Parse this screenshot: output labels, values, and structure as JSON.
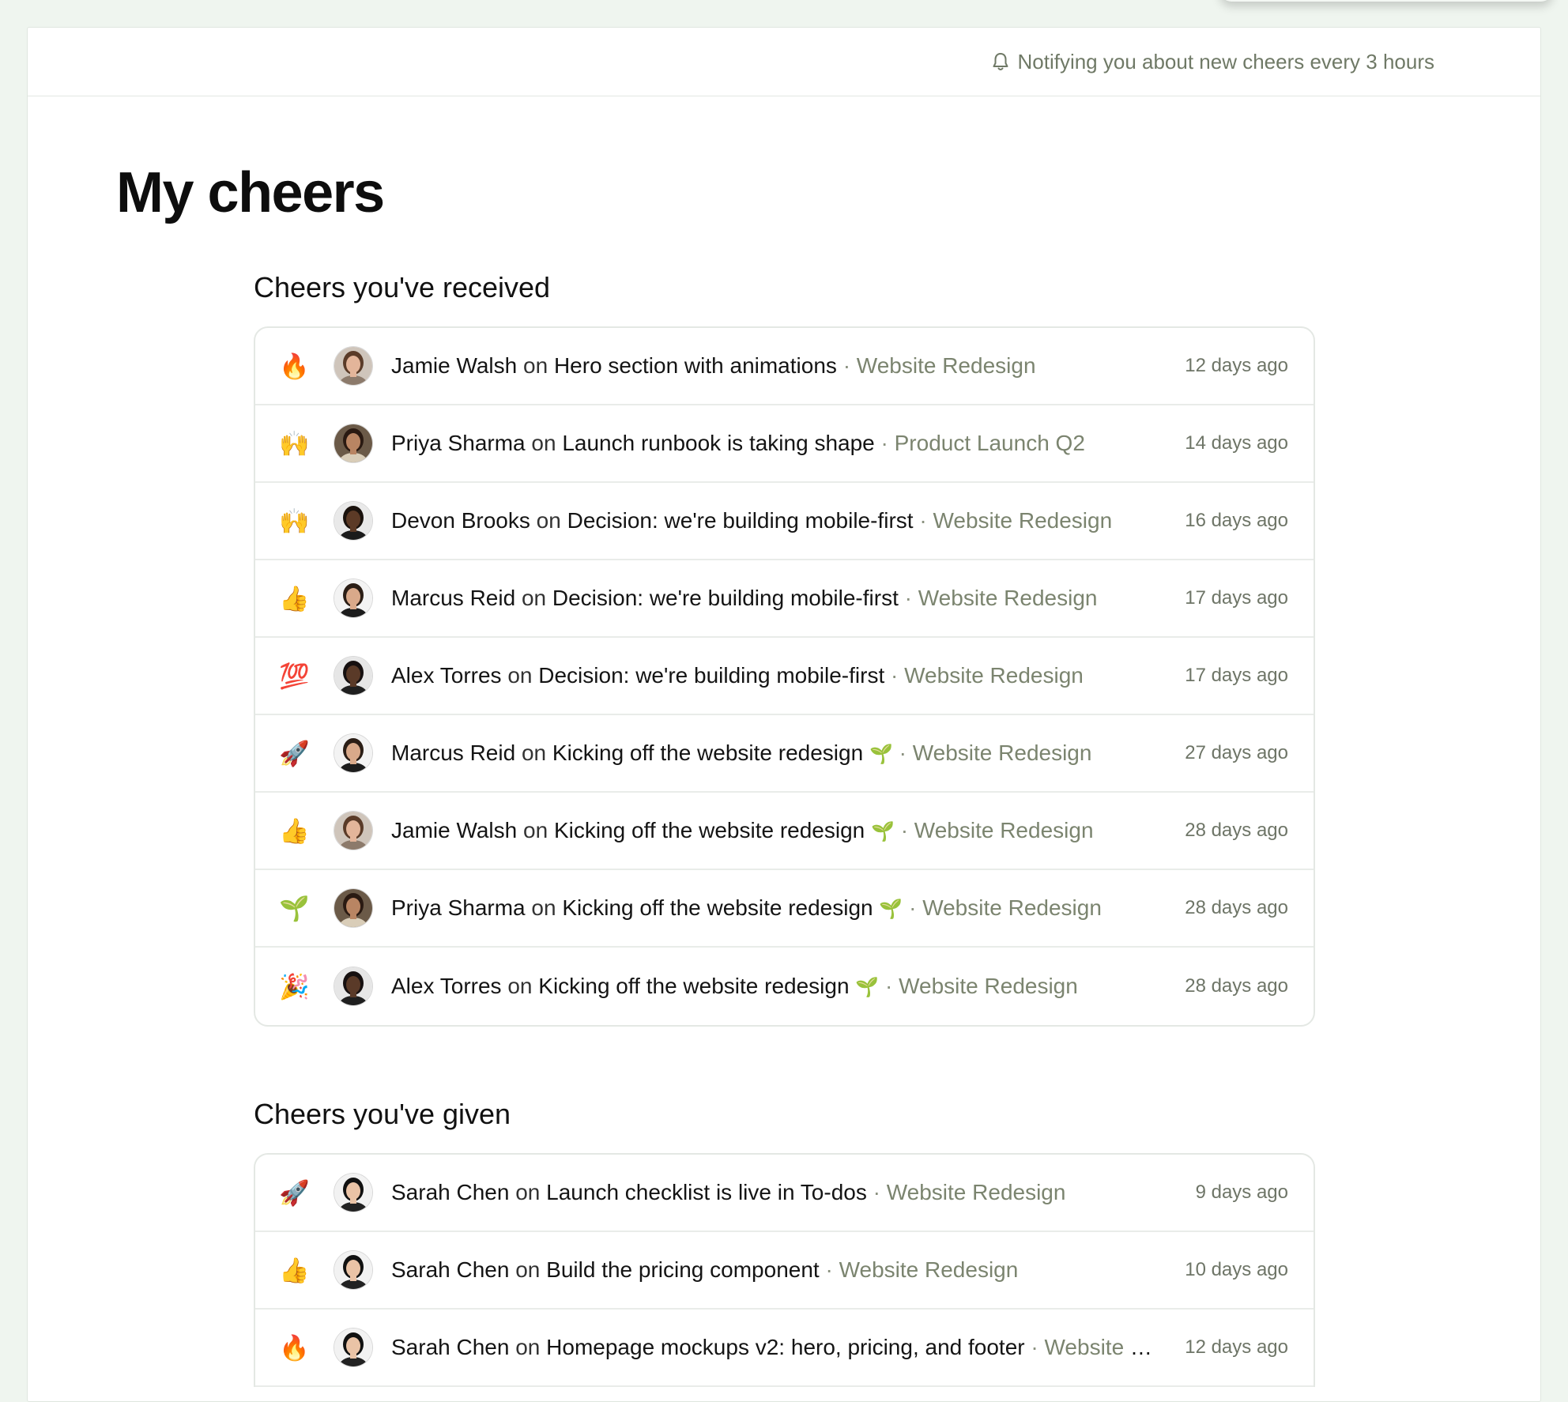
{
  "header": {
    "notify_icon": "bell-icon",
    "notify_text": "Notifying you about new cheers every 3 hours"
  },
  "page_title": "My cheers",
  "received": {
    "title": "Cheers you've received",
    "items": [
      {
        "emoji": "🔥",
        "person": "Jamie Walsh",
        "on": "on",
        "post": "Hero section with animations",
        "post_emoji": "",
        "project": "Website Redesign",
        "time": "12 days ago",
        "avatar": "jamie"
      },
      {
        "emoji": "🙌",
        "person": "Priya Sharma",
        "on": "on",
        "post": "Launch runbook is taking shape",
        "post_emoji": "",
        "project": "Product Launch Q2",
        "time": "14 days ago",
        "avatar": "priya"
      },
      {
        "emoji": "🙌",
        "person": "Devon Brooks",
        "on": "on",
        "post": "Decision: we're building mobile-first",
        "post_emoji": "",
        "project": "Website Redesign",
        "time": "16 days ago",
        "avatar": "devon"
      },
      {
        "emoji": "👍",
        "person": "Marcus Reid",
        "on": "on",
        "post": "Decision: we're building mobile-first",
        "post_emoji": "",
        "project": "Website Redesign",
        "time": "17 days ago",
        "avatar": "marcus"
      },
      {
        "emoji": "💯",
        "person": "Alex Torres",
        "on": "on",
        "post": "Decision: we're building mobile-first",
        "post_emoji": "",
        "project": "Website Redesign",
        "time": "17 days ago",
        "avatar": "alex"
      },
      {
        "emoji": "🚀",
        "person": "Marcus Reid",
        "on": "on",
        "post": "Kicking off the website redesign",
        "post_emoji": "🌱",
        "project": "Website Redesign",
        "time": "27 days ago",
        "avatar": "marcus"
      },
      {
        "emoji": "👍",
        "person": "Jamie Walsh",
        "on": "on",
        "post": "Kicking off the website redesign",
        "post_emoji": "🌱",
        "project": "Website Redesign",
        "time": "28 days ago",
        "avatar": "jamie"
      },
      {
        "emoji": "🌱",
        "person": "Priya Sharma",
        "on": "on",
        "post": "Kicking off the website redesign",
        "post_emoji": "🌱",
        "project": "Website Redesign",
        "time": "28 days ago",
        "avatar": "priya"
      },
      {
        "emoji": "🎉",
        "person": "Alex Torres",
        "on": "on",
        "post": "Kicking off the website redesign",
        "post_emoji": "🌱",
        "project": "Website Redesign",
        "time": "28 days ago",
        "avatar": "alex"
      }
    ]
  },
  "given": {
    "title": "Cheers you've given",
    "items": [
      {
        "emoji": "🚀",
        "person": "Sarah Chen",
        "on": "on",
        "post": "Launch checklist is live in To-dos",
        "post_emoji": "",
        "project": "Website Redesign",
        "time": "9 days ago",
        "avatar": "sarah"
      },
      {
        "emoji": "👍",
        "person": "Sarah Chen",
        "on": "on",
        "post": "Build the pricing component",
        "post_emoji": "",
        "project": "Website Redesign",
        "time": "10 days ago",
        "avatar": "sarah"
      },
      {
        "emoji": "🔥",
        "person": "Sarah Chen",
        "on": "on",
        "post": "Homepage mockups v2: hero, pricing, and footer",
        "post_emoji": "",
        "project": "Website Redesign",
        "time": "12 days ago",
        "avatar": "sarah"
      }
    ]
  },
  "avatar_colors": {
    "jamie": {
      "bg": "#cfc5bb",
      "skin": "#e3b59a",
      "hair": "#5a3b28",
      "shirt": "#8c7a6b"
    },
    "priya": {
      "bg": "#6b5a48",
      "skin": "#b98563",
      "hair": "#2a1a12",
      "shirt": "#d9cdb8"
    },
    "devon": {
      "bg": "#e9e9e9",
      "skin": "#5c3a26",
      "hair": "#1a120d",
      "shirt": "#1b1b1b"
    },
    "marcus": {
      "bg": "#f3f3f3",
      "skin": "#d9a98a",
      "hair": "#2b1e16",
      "shirt": "#1c1c1c"
    },
    "alex": {
      "bg": "#e6e6e6",
      "skin": "#5a3a28",
      "hair": "#161010",
      "shirt": "#1f1f1f"
    },
    "sarah": {
      "bg": "#f2f2f2",
      "skin": "#eac3a6",
      "hair": "#111111",
      "shirt": "#222222"
    }
  }
}
